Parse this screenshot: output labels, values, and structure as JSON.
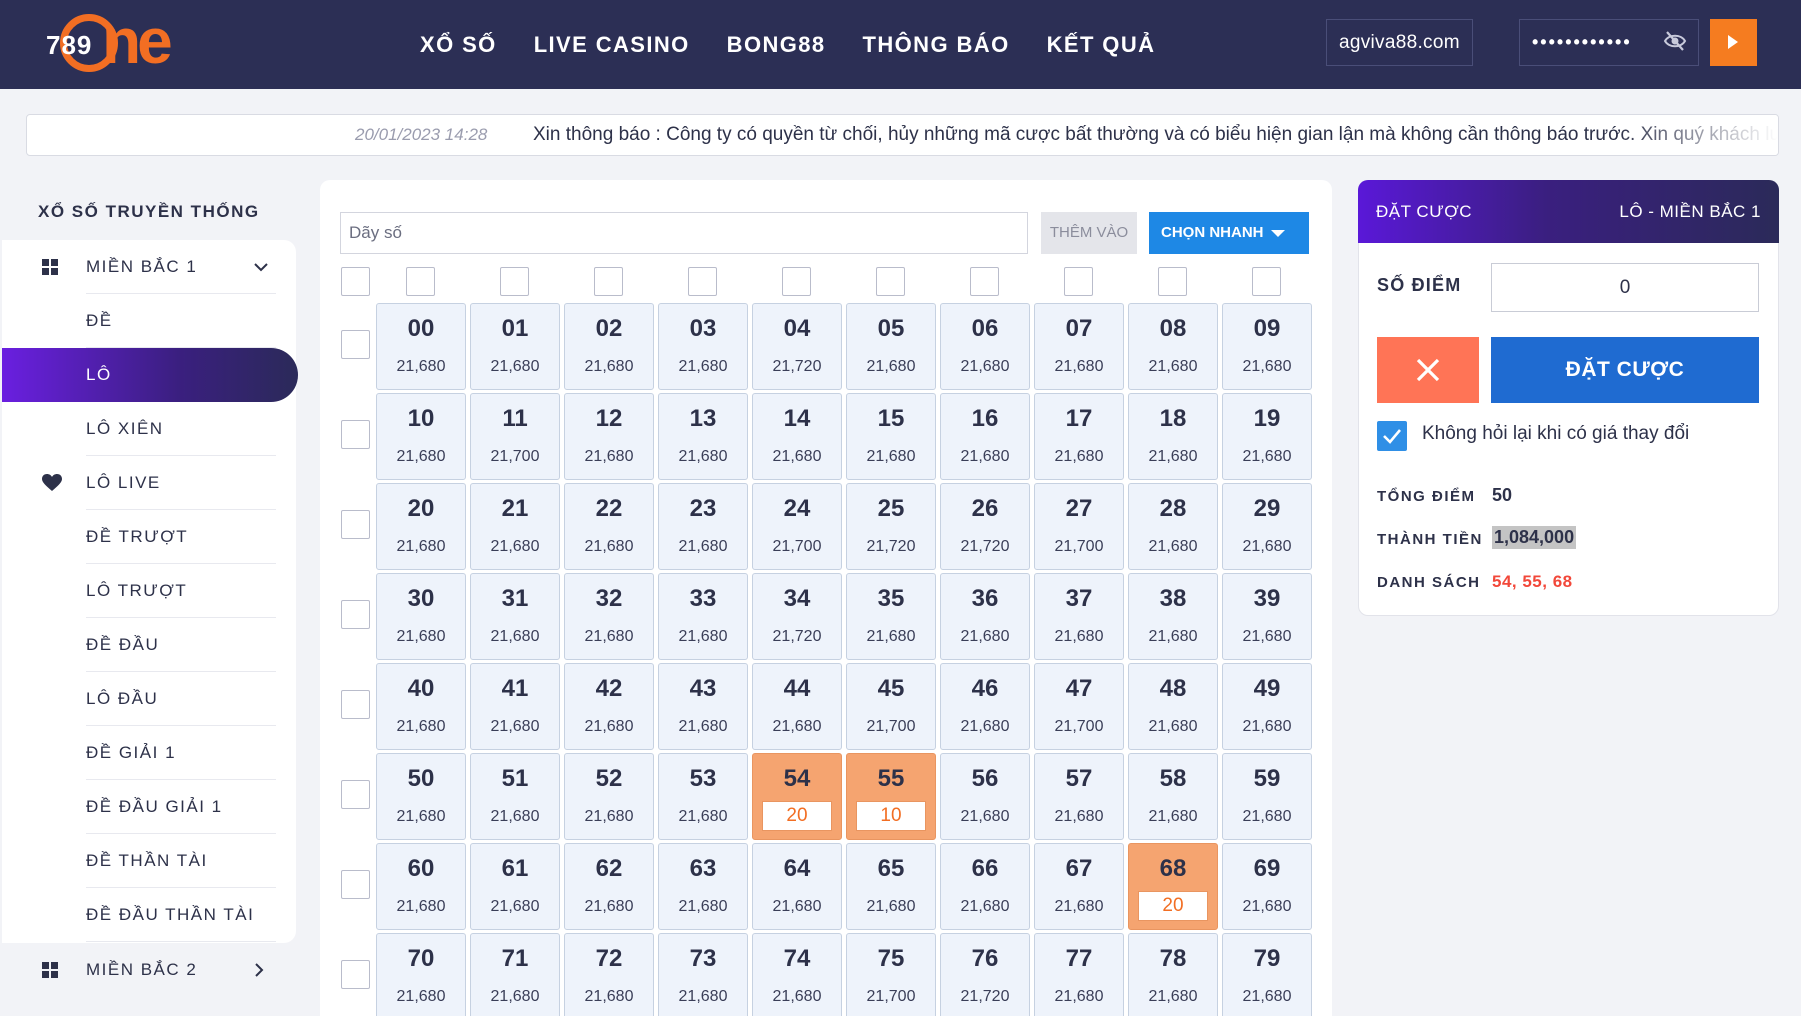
{
  "header": {
    "logo_number": "789",
    "logo_text": "ne",
    "nav": [
      "XỔ SỐ",
      "LIVE CASINO",
      "BONG88",
      "THÔNG BÁO",
      "KẾT QUẢ"
    ],
    "username": "agviva88.com",
    "password_mask": "••••••••••••"
  },
  "marquee": {
    "date": "20/01/2023 14:28",
    "message": "Xin thông báo : Công ty có quyền từ chối, hủy những mã cược bất thường và có biểu hiện gian lận mà không cần thông báo trước. Xin quý khách lưu"
  },
  "sidebar": {
    "title": "XỔ SỐ TRUYỀN THỐNG",
    "items": [
      {
        "label": "MIỀN BẮC 1",
        "icon": "grid-icon",
        "chevron": "down"
      },
      {
        "label": "ĐỀ"
      },
      {
        "label": "LÔ",
        "active": true
      },
      {
        "label": "LÔ XIÊN"
      },
      {
        "label": "LÔ LIVE",
        "icon": "heart-icon"
      },
      {
        "label": "ĐỀ TRƯỢT"
      },
      {
        "label": "LÔ TRƯỢT"
      },
      {
        "label": "ĐỀ ĐẦU"
      },
      {
        "label": "LÔ ĐẦU"
      },
      {
        "label": "ĐỀ GIẢI 1"
      },
      {
        "label": "ĐỀ ĐẦU GIẢI 1"
      },
      {
        "label": "ĐỀ THẦN TÀI"
      },
      {
        "label": "ĐỀ ĐẦU THẦN TÀI"
      }
    ],
    "footer_item": {
      "label": "MIỀN BẮC 2",
      "icon": "grid-icon",
      "chevron": "right"
    }
  },
  "toolbar": {
    "input_placeholder": "Dãy số",
    "add_label": "THÊM VÀO",
    "quick_label": "CHỌN NHANH"
  },
  "grid": {
    "rows": [
      [
        "21,680",
        "21,680",
        "21,680",
        "21,680",
        "21,720",
        "21,680",
        "21,680",
        "21,680",
        "21,680",
        "21,680"
      ],
      [
        "21,680",
        "21,700",
        "21,680",
        "21,680",
        "21,680",
        "21,680",
        "21,680",
        "21,680",
        "21,680",
        "21,680"
      ],
      [
        "21,680",
        "21,680",
        "21,680",
        "21,680",
        "21,700",
        "21,720",
        "21,720",
        "21,700",
        "21,680",
        "21,680"
      ],
      [
        "21,680",
        "21,680",
        "21,680",
        "21,680",
        "21,720",
        "21,680",
        "21,680",
        "21,680",
        "21,680",
        "21,680"
      ],
      [
        "21,680",
        "21,680",
        "21,680",
        "21,680",
        "21,680",
        "21,700",
        "21,680",
        "21,700",
        "21,680",
        "21,680"
      ],
      [
        "21,680",
        "21,680",
        "21,680",
        "21,680",
        "",
        "",
        "21,680",
        "21,680",
        "21,680",
        "21,680"
      ],
      [
        "21,680",
        "21,680",
        "21,680",
        "21,680",
        "21,680",
        "21,680",
        "21,680",
        "21,680",
        "",
        "21,680"
      ],
      [
        "21,680",
        "21,680",
        "21,680",
        "21,680",
        "21,680",
        "21,700",
        "21,720",
        "21,680",
        "21,680",
        "21,680"
      ]
    ],
    "selected": {
      "54": "20",
      "55": "10",
      "68": "20"
    },
    "selected_color": "#f5a470"
  },
  "bet": {
    "title": "ĐẶT CƯỢC",
    "subtitle": "LÔ - MIỀN BẮC 1",
    "points_label": "SỐ ĐIỂM",
    "points_value": "0",
    "submit_label": "ĐẶT CƯỢC",
    "confirm_label": "Không hỏi lại khi có giá thay đổi",
    "confirm_checked": true,
    "total_label": "TỔNG ĐIỂM",
    "total_value": "50",
    "amount_label": "THÀNH TIỀN",
    "amount_value": "1,084,000",
    "list_label": "DANH SÁCH",
    "list_value": "54, 55, 68"
  }
}
